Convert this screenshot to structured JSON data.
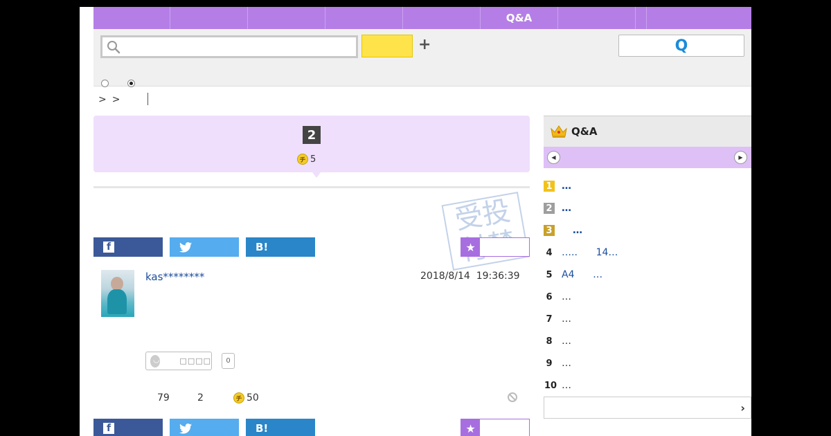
{
  "topnav": {
    "items": [
      "",
      "",
      "",
      "",
      "",
      "Q&A",
      "",
      "",
      ""
    ]
  },
  "search": {
    "placeholder": "",
    "value": "",
    "search_button_label": "",
    "add_symbol": "+",
    "qa_button_label": "Q"
  },
  "breadcrumb": {
    "items": [
      ">",
      ">"
    ]
  },
  "question": {
    "rank_number": "2",
    "coin_value": "5",
    "coin_symbol": "チ"
  },
  "stamp": {
    "text_top": "受投",
    "text_bottom": "付禁"
  },
  "share": {
    "facebook_icon": "f",
    "twitter_icon": "🐦",
    "hatena_label": "B!",
    "favorite_star": "★"
  },
  "answer": {
    "username": "kas********",
    "date": "2018/8/14",
    "time": "19:36:39",
    "reaction_label": "□□□□",
    "reaction_count": "0",
    "views": "79",
    "answers": "2",
    "coin_value": "50",
    "coin_symbol": "チ"
  },
  "sidebar": {
    "title": "Q&A",
    "ranking": [
      {
        "num": "1",
        "text": "…"
      },
      {
        "num": "2",
        "text": "…"
      },
      {
        "num": "3",
        "text": "…"
      },
      {
        "num": "4",
        "text": "…..      14…"
      },
      {
        "num": "5",
        "text": "A4      …"
      },
      {
        "num": "6",
        "text": "…"
      },
      {
        "num": "7",
        "text": "…"
      },
      {
        "num": "8",
        "text": "…"
      },
      {
        "num": "9",
        "text": "…"
      },
      {
        "num": "10",
        "text": "…"
      }
    ],
    "more_chevron": "›"
  },
  "colors": {
    "nav_purple": "#b57ee6",
    "header_bg": "#efdffc",
    "link_blue": "#1a4d9e",
    "facebook": "#3b5998",
    "twitter": "#55acee",
    "hatena": "#2a86c8"
  }
}
